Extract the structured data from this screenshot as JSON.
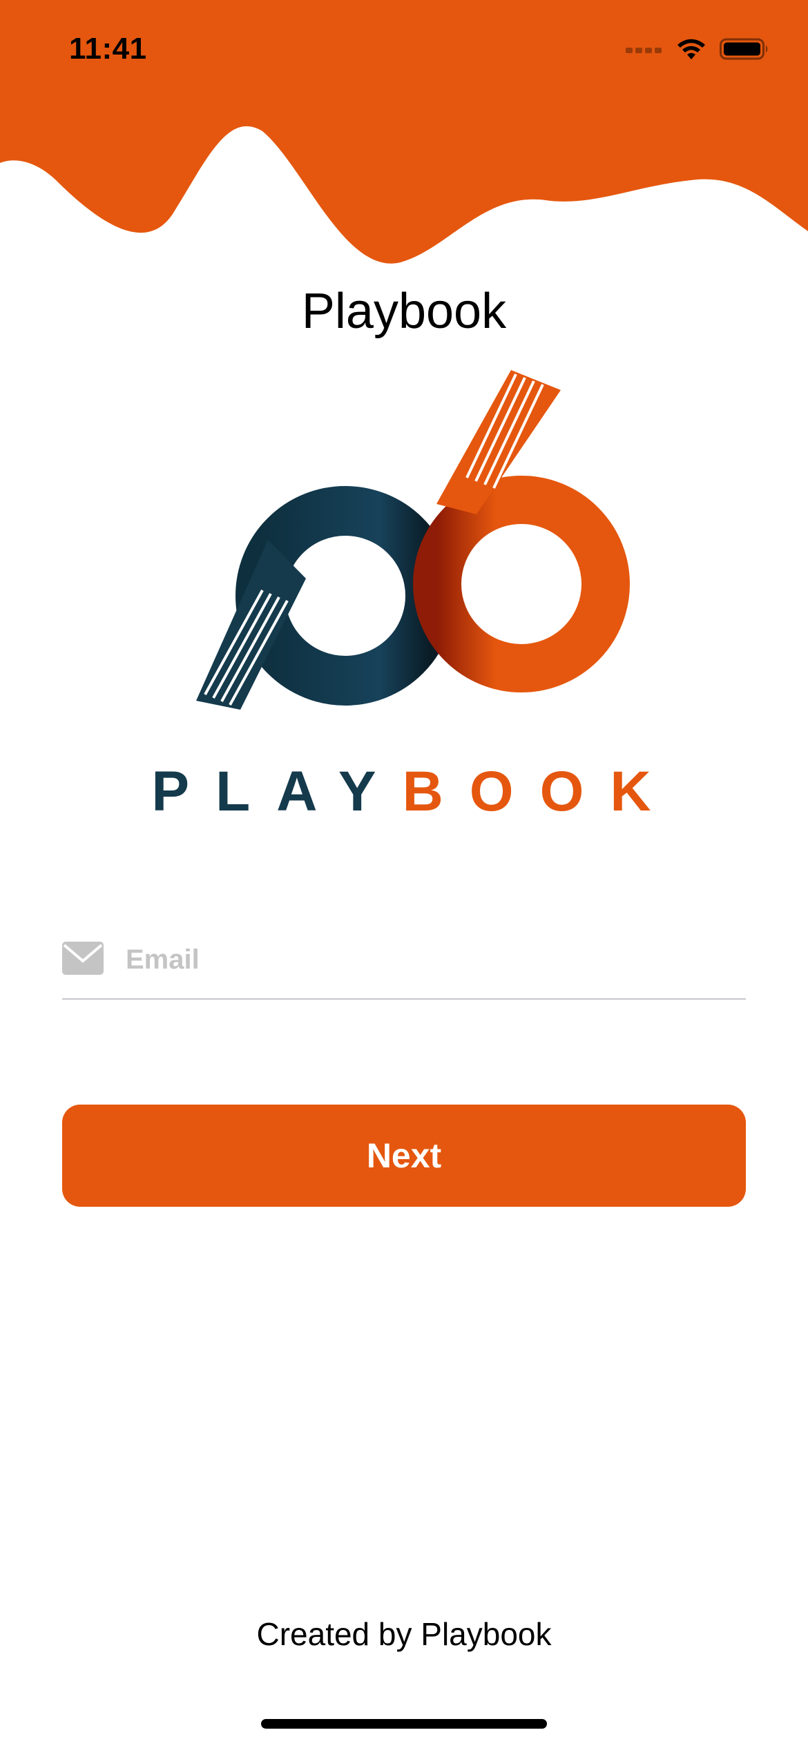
{
  "status_bar": {
    "time": "11:41",
    "icons": [
      "signal-icon",
      "wifi-icon",
      "battery-icon"
    ]
  },
  "header": {
    "title": "Playbook"
  },
  "logo": {
    "wordmark_part1": "PLAY",
    "wordmark_part2": "BOOK",
    "icon": "playbook-logo-icon"
  },
  "form": {
    "email_placeholder": "Email",
    "email_value": "",
    "email_icon": "envelope-icon",
    "next_label": "Next"
  },
  "footer": {
    "text": "Created by Playbook"
  },
  "colors": {
    "accent": "#e5570e",
    "brand_dark": "#143a4c",
    "background": "#ffffff",
    "placeholder": "#c4c4c4",
    "divider": "#c7c7cc"
  }
}
